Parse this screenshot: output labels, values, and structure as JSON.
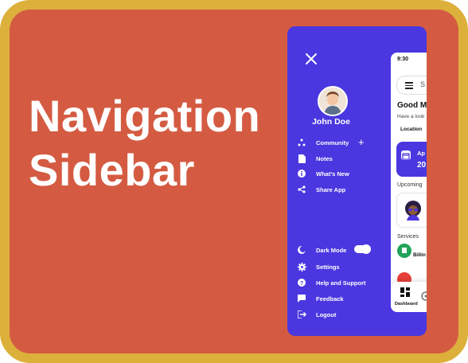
{
  "headline": {
    "line1": "Navigation",
    "line2": "Sidebar"
  },
  "colors": {
    "background": "#d45b42",
    "border": "#dcb03a",
    "sidebar": "#4a37e0",
    "accent_green": "#22a45a",
    "accent_red": "#e8403a"
  },
  "sidebar": {
    "close_icon": "close-icon",
    "user_name": "John Doe",
    "items": [
      {
        "label": "Community",
        "icon": "community-icon"
      },
      {
        "label": "Notes",
        "icon": "notes-icon"
      },
      {
        "label": "What's New",
        "icon": "info-icon"
      },
      {
        "label": "Share App",
        "icon": "share-icon"
      }
    ],
    "community_add": "+",
    "bottom_items": [
      {
        "label": "Dark Mode",
        "icon": "moon-icon",
        "toggle_on": true
      },
      {
        "label": "Settings",
        "icon": "gear-icon"
      },
      {
        "label": "Help and Support",
        "icon": "help-icon"
      },
      {
        "label": "Feedback",
        "icon": "feedback-icon"
      },
      {
        "label": "Logout",
        "icon": "logout-icon"
      }
    ]
  },
  "app_screen": {
    "time": "9:30",
    "search_partial": "S",
    "greeting": "Good M",
    "subtext": "Have a look",
    "location_label": "Location",
    "appointment_partial": "Ap",
    "appointment_number": "20",
    "upcoming_label": "Upcoming",
    "services_label": "Services",
    "service_1": "Billin",
    "bottom_tab": "Dashboard"
  }
}
